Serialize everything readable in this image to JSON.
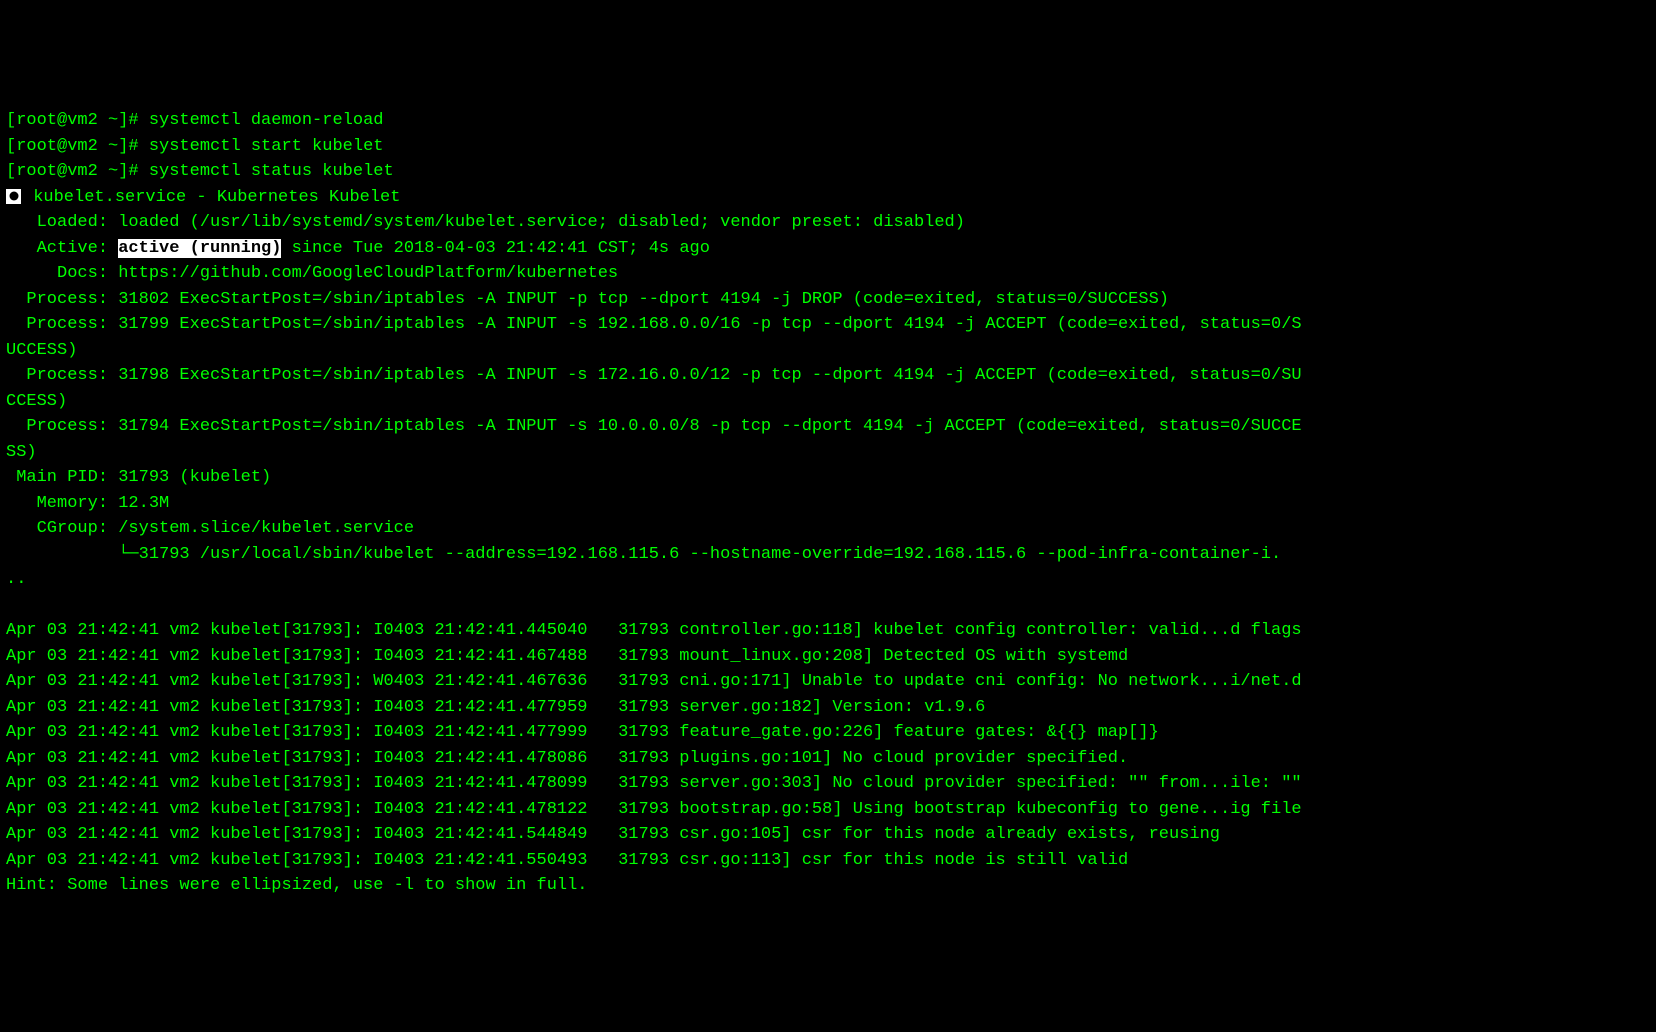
{
  "prompt1": "[root@vm2 ~]# ",
  "cmd1": "systemctl daemon-reload",
  "prompt2": "[root@vm2 ~]# ",
  "cmd2": "systemctl start kubelet",
  "prompt3": "[root@vm2 ~]# ",
  "cmd3": "systemctl status kubelet",
  "unit_line": " kubelet.service - Kubernetes Kubelet",
  "loaded": "   Loaded: loaded (/usr/lib/systemd/system/kubelet.service; disabled; vendor preset: disabled)",
  "active_label": "   Active: ",
  "active_value": "active (running)",
  "active_rest": " since Tue 2018-04-03 21:42:41 CST; 4s ago",
  "docs": "     Docs: https://github.com/GoogleCloudPlatform/kubernetes",
  "process1": "  Process: 31802 ExecStartPost=/sbin/iptables -A INPUT -p tcp --dport 4194 -j DROP (code=exited, status=0/SUCCESS)",
  "process2a": "  Process: 31799 ExecStartPost=/sbin/iptables -A INPUT -s 192.168.0.0/16 -p tcp --dport 4194 -j ACCEPT (code=exited, status=0/S",
  "process2b": "UCCESS)",
  "process3a": "  Process: 31798 ExecStartPost=/sbin/iptables -A INPUT -s 172.16.0.0/12 -p tcp --dport 4194 -j ACCEPT (code=exited, status=0/SU",
  "process3b": "CCESS)",
  "process4a": "  Process: 31794 ExecStartPost=/sbin/iptables -A INPUT -s 10.0.0.0/8 -p tcp --dport 4194 -j ACCEPT (code=exited, status=0/SUCCE",
  "process4b": "SS)",
  "mainpid": " Main PID: 31793 (kubelet)",
  "memory": "   Memory: 12.3M",
  "cgroup": "   CGroup: /system.slice/kubelet.service",
  "cgroup_tree": "           └─31793 /usr/local/sbin/kubelet --address=192.168.115.6 --hostname-override=192.168.115.6 --pod-infra-container-i.",
  "cgroup_tree2": "..",
  "log1": "Apr 03 21:42:41 vm2 kubelet[31793]: I0403 21:42:41.445040   31793 controller.go:118] kubelet config controller: valid...d flags",
  "log2": "Apr 03 21:42:41 vm2 kubelet[31793]: I0403 21:42:41.467488   31793 mount_linux.go:208] Detected OS with systemd",
  "log3": "Apr 03 21:42:41 vm2 kubelet[31793]: W0403 21:42:41.467636   31793 cni.go:171] Unable to update cni config: No network...i/net.d",
  "log4": "Apr 03 21:42:41 vm2 kubelet[31793]: I0403 21:42:41.477959   31793 server.go:182] Version: v1.9.6",
  "log5": "Apr 03 21:42:41 vm2 kubelet[31793]: I0403 21:42:41.477999   31793 feature_gate.go:226] feature gates: &{{} map[]}",
  "log6": "Apr 03 21:42:41 vm2 kubelet[31793]: I0403 21:42:41.478086   31793 plugins.go:101] No cloud provider specified.",
  "log7": "Apr 03 21:42:41 vm2 kubelet[31793]: I0403 21:42:41.478099   31793 server.go:303] No cloud provider specified: \"\" from...ile: \"\"",
  "log8": "Apr 03 21:42:41 vm2 kubelet[31793]: I0403 21:42:41.478122   31793 bootstrap.go:58] Using bootstrap kubeconfig to gene...ig file",
  "log9": "Apr 03 21:42:41 vm2 kubelet[31793]: I0403 21:42:41.544849   31793 csr.go:105] csr for this node already exists, reusing",
  "log10": "Apr 03 21:42:41 vm2 kubelet[31793]: I0403 21:42:41.550493   31793 csr.go:113] csr for this node is still valid",
  "hint": "Hint: Some lines were ellipsized, use -l to show in full."
}
